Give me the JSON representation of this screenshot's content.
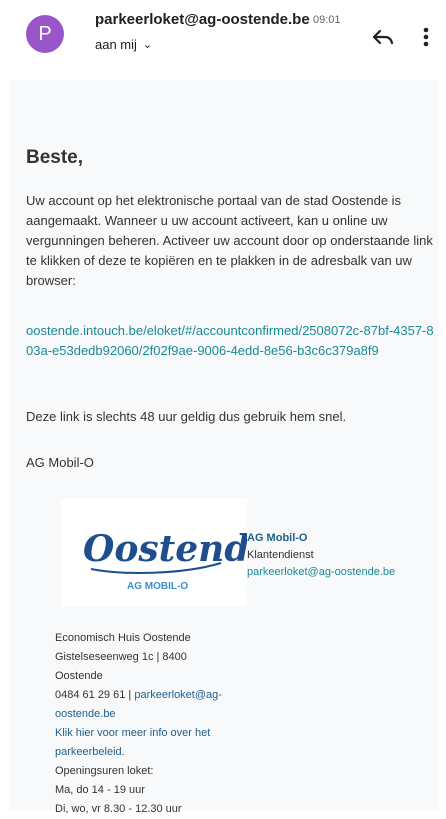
{
  "header": {
    "avatar_letter": "P",
    "avatar_color": "#9a56c9",
    "sender": "parkeerloket@ag-oostende.be",
    "time": "09:01",
    "recipient": "aan mij",
    "reply_icon": "reply-icon",
    "more_icon": "more-vert-icon"
  },
  "email": {
    "greeting": "Beste,",
    "paragraph1": "Uw account op het elektronische portaal van de stad Oostende is aangemaakt. Wanneer u uw account activeert, kan u online uw vergunningen beheren. Activeer uw account door op onderstaande link te klikken of deze te kopiëren en te plakken in de adresbalk van uw browser:",
    "link": "oostende.intouch.be/eloket/#/accountconfirmed/2508072c-87bf-4357-803a-e53dedb92060/2f02f9ae-9006-4edd-8e56-b3c6c379a8f9",
    "paragraph2": "Deze link is slechts 48 uur geldig dus gebruik hem snel.",
    "signoff": "AG Mobil-O"
  },
  "signature": {
    "logo_text": "Oostende",
    "logo_subtext": "AG MOBIL-O",
    "name": "AG Mobil-O",
    "department": "Klantendienst",
    "email": "parkeerloket@ag-oostende.be"
  },
  "address": {
    "line1": "Economisch Huis Oostende",
    "line2": "Gistelseseenweg 1c | 8400",
    "line3": "Oostende",
    "phone": "0484 61 29 61 | ",
    "email_link_1": "parkeerloket@ag-",
    "email_link_2": "oostende.be",
    "info_link_1": "Klik hier voor meer info over het",
    "info_link_2": "parkeerbeleid.",
    "hours_title": "Openingsuren loket:",
    "hours1": "Ma, do 14 - 19 uur",
    "hours2": "Di, wo, vr 8.30 - 12.30 uur"
  },
  "colors": {
    "link": "#1a8a96",
    "logo_blue": "#1f4e8c",
    "logo_light": "#3a8fd0"
  }
}
